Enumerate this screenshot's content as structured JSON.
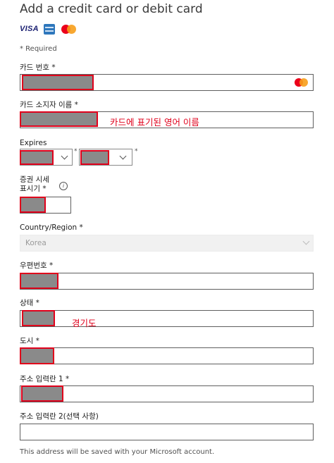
{
  "header": {
    "title": "Add a credit card or debit card"
  },
  "card_logos": {
    "visa_text": "VISA",
    "amex_icon": "amex-card-icon",
    "mastercard_icon": "mastercard-icon"
  },
  "required_note": "* Required",
  "fields": {
    "card_number": {
      "label": "카드 번호 *",
      "value": ""
    },
    "cardholder_name": {
      "label": "카드 소지자 이름 *",
      "value": "",
      "hint": "카드에 표기된 영어 이름"
    },
    "expires": {
      "label": "Expires",
      "month": "",
      "year": "",
      "required_mark": "*"
    },
    "cvv": {
      "label_line1": "증권 시세",
      "label_line2": "표시기 *",
      "info_symbol": "i",
      "value": ""
    },
    "country": {
      "label": "Country/Region *",
      "value": "Korea"
    },
    "postal_code": {
      "label": "우편번호 *",
      "value": ""
    },
    "state": {
      "label": "상태 *",
      "value": "",
      "hint": "경기도"
    },
    "city": {
      "label": "도시 *",
      "value": ""
    },
    "address1": {
      "label": "주소 입력란 1 *",
      "value": ""
    },
    "address2": {
      "label": "주소 입력란 2(선택 사항)",
      "value": ""
    }
  },
  "footer_note": "This address will be saved with your Microsoft account.",
  "colors": {
    "redaction_border": "#e0001b",
    "redaction_fill": "#8a8a8a",
    "hint_text": "#e0001b",
    "visa": "#1a1f71",
    "amex": "#2e77bc",
    "mastercard_red": "#eb001b",
    "mastercard_orange": "#f79e1b"
  }
}
